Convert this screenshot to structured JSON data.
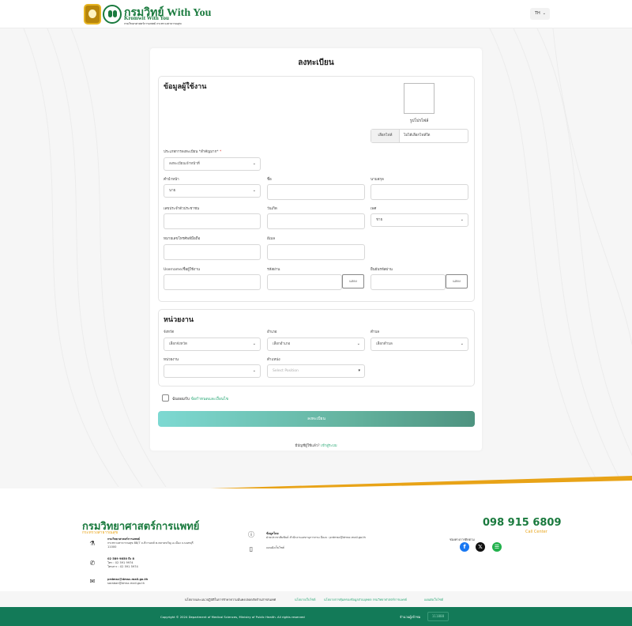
{
  "header": {
    "brand_main": "กรมวิทย์ With You",
    "brand_sub": "Kromwit With You",
    "brand_small": "กรมวิทยาศาสตร์การแพทย์ กระทรวงสาธารณสุข",
    "lang": "TH"
  },
  "form": {
    "title": "ลงทะเบียน",
    "user_section": {
      "title": "ข้อมูลผู้ใช้งาน",
      "photo_label": "รูปโปรไฟล์",
      "file_button": "เลือกไฟล์",
      "file_status": "ไม่ได้เลือกไฟล์ใด",
      "type_label": "ประเภทการลงทะเบียน *สำคัญมาก*",
      "type_value": "ลงทะเบียนเจ้าหน้าที่",
      "prefix_label": "คำนำหน้า",
      "prefix_value": "นาย",
      "firstname_label": "ชื่อ",
      "lastname_label": "นามสกุล",
      "idcard_label": "เลขประจำตัวประชาชน",
      "birthdate_label": "วันเกิด",
      "gender_label": "เพศ",
      "gender_value": "ชาย",
      "phone_label": "หมายเลขโทรศัพท์มือถือ",
      "email_label": "อีเมล",
      "username_label": "Username/ชื่อผู้ใช้งาน",
      "password_label": "รหัสผ่าน",
      "confirm_label": "ยืนยันรหัสผ่าน",
      "show_label": "แสดง"
    },
    "org_section": {
      "title": "หน่วยงาน",
      "province_label": "จังหวัด",
      "province_value": "เลือกจังหวัด",
      "district_label": "อำเภอ",
      "district_value": "เลือกอำเภอ",
      "subdistrict_label": "ตำบล",
      "subdistrict_value": "เลือกตำบล",
      "agency_label": "หน่วยงาน",
      "position_label": "ตำแหน่ง",
      "position_placeholder": "Select Position"
    },
    "consent_text": "ฉันยอมรับ",
    "consent_link": "ข้อกำหนดและเงื่อนไข",
    "submit_label": "ลงทะเบียน",
    "have_account": "มีบัญชีผู้ใช้แล้ว?",
    "login_link": "เข้าสู่ระบบ"
  },
  "footer": {
    "title": "กรมวิทยาศาสตร์การแพทย์",
    "subtitle": "กระทรวงสาธารณสุข",
    "address_title": "กรมวิทยาศาสตร์การแพทย์",
    "address_line1": "กระทรวงสาธารณสุข 88/7 ถ.ติวานนท์ ต.ตลาดขวัญ อ.เมือง จ.นนทบุรี",
    "address_line2": "11000",
    "phone_main": "02 589 9850 ถึง 8",
    "phone_tel": "โทร : 02 591 9974",
    "phone_fax": "โทรสาร : 02 591 5974",
    "email1": "prdmsc@dmsc.mail.go.th",
    "email2": "saraban@dmsc.mail.go.th",
    "info_title": "ข้อมูลโดย",
    "info_text": "ฝ่ายประชาสัมพันธ์ สำนักงานเลขานุการกรม อีเมล : prdmsc@dmsc.mail.go.th",
    "sitemap": "แผนผังเว็บไซต์",
    "call_number": "098 915 6809",
    "call_label": "Call Center",
    "social_label": "ช่องทางการติดตาม",
    "links": [
      "นโยบายและแนวปฏิบัติในการรักษาความมั่นคงปลอดภัยด้านสารสนเทศ",
      "นโยบายเว็บไซต์",
      "นโยบายการคุ้มครองข้อมูลส่วนบุคคล กรมวิทยาศาสตร์การแพทย์",
      "แผนผังเว็บไซต์"
    ],
    "copyright": "Copyright © 2024 Department of Medical Sciences, Ministry of Public Health. All rights reserved",
    "visitors_label": "จำนวนผู้เข้าชม",
    "visitors_count": "111888"
  },
  "colors": {
    "brand_green": "#1a7a3e",
    "accent_orange": "#e8a317",
    "footer_green": "#137a58",
    "link_green": "#2aa876"
  }
}
